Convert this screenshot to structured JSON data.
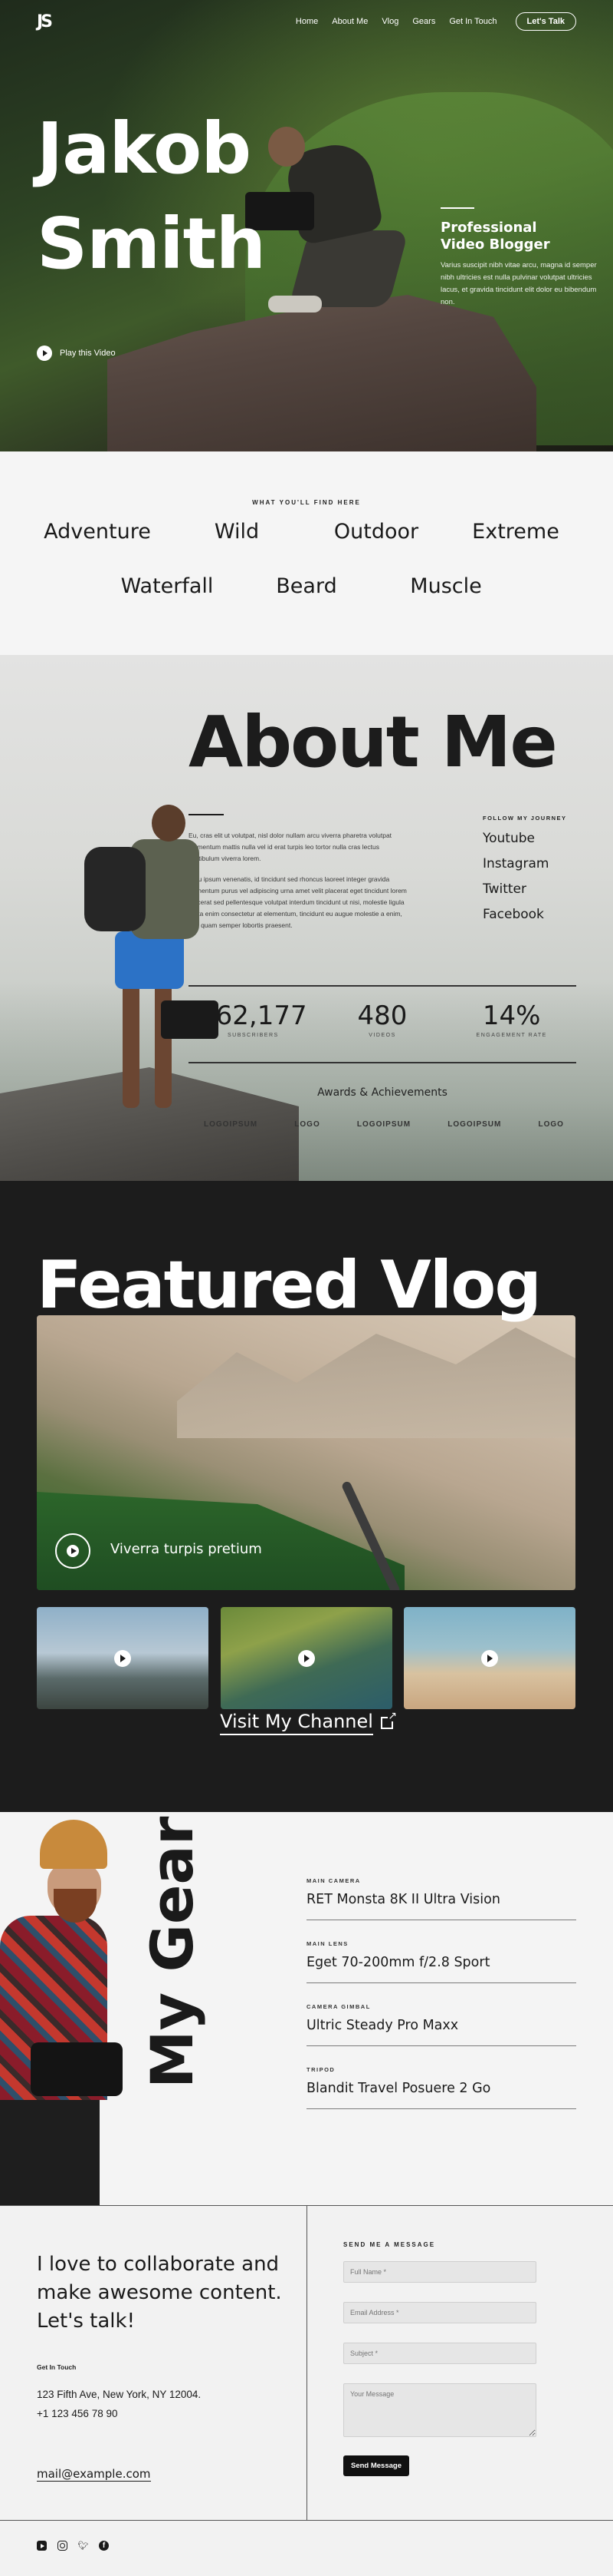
{
  "nav": {
    "logo": "JS",
    "links": [
      "Home",
      "About Me",
      "Vlog",
      "Gears",
      "Get In Touch"
    ],
    "cta": "Let's Talk"
  },
  "hero": {
    "first_name": "Jakob",
    "last_name": "Smith",
    "role_line1": "Professional",
    "role_line2": "Video Blogger",
    "description": "Varius suscipit nibh vitae arcu, magna id semper nibh ultricies est nulla pulvinar volutpat ultricies lacus, et gravida tincidunt elit dolor eu bibendum non.",
    "play_label": "Play this Video"
  },
  "topics": {
    "eyebrow": "WHAT YOU'LL FIND HERE",
    "row1": [
      "Adventure",
      "Wild",
      "Outdoor",
      "Extreme"
    ],
    "row2": [
      "Waterfall",
      "Beard",
      "Muscle"
    ]
  },
  "about": {
    "title": "About Me",
    "para1": "Eu, cras elit ut volutpat, nisl dolor nullam arcu viverra pharetra volutpat elementum mattis nulla vel id erat turpis leo tortor nulla cras lectus vestibulum viverra lorem.",
    "para2": "Arcu ipsum venenatis, id tincidunt sed rhoncus laoreet integer gravida fermentum purus vel adipiscing urna amet velit placerat eget tincidunt lorem placerat sed pellentesque volutpat interdum tincidunt ut nisi, molestie ligula porta enim consectetur at elementum, tincidunt eu augue molestie a enim, sed quam semper lobortis praesent.",
    "follow_label": "FOLLOW MY JOURNEY",
    "socials": [
      "Youtube",
      "Instagram",
      "Twitter",
      "Facebook"
    ],
    "stats": [
      {
        "num": "362,177",
        "cap": "SUBSCRIBERS"
      },
      {
        "num": "480",
        "cap": "VIDEOS"
      },
      {
        "num": "14%",
        "cap": "ENGAGEMENT RATE"
      }
    ],
    "awards_title": "Awards & Achievements",
    "award_logos": [
      "LOGOIPSUM",
      "LOGO",
      "LOGOIPSUM",
      "LOGOIPSUM",
      "LOGO"
    ]
  },
  "vlog": {
    "title": "Featured Vlog",
    "main_video_title": "Viverra turpis pretium",
    "channel_link": "Visit My Channel"
  },
  "gear": {
    "title": "My Gear",
    "items": [
      {
        "label": "MAIN CAMERA",
        "value": "RET Monsta 8K II Ultra Vision"
      },
      {
        "label": "MAIN LENS",
        "value": "Eget 70-200mm f/2.8 Sport"
      },
      {
        "label": "CAMERA GIMBAL",
        "value": "Ultric Steady Pro Maxx"
      },
      {
        "label": "TRIPOD",
        "value": "Blandit Travel Posuere 2 Go"
      }
    ]
  },
  "contact": {
    "headline": "I love to collaborate and make awesome content. Let's talk!",
    "get_in_touch_label": "Get In Touch",
    "address": "123 Fifth Ave, New York, NY 12004.",
    "phone": "+1 123 456 78 90",
    "email": "mail@example.com",
    "form_label": "SEND ME A MESSAGE",
    "fields": {
      "name_placeholder": "Full Name *",
      "email_placeholder": "Email Address *",
      "subject_placeholder": "Subject *",
      "message_placeholder": "Your Message"
    },
    "send_button": "Send Message"
  },
  "footer": {
    "social_icons": [
      "youtube-icon",
      "instagram-icon",
      "twitter-icon",
      "facebook-icon"
    ]
  }
}
